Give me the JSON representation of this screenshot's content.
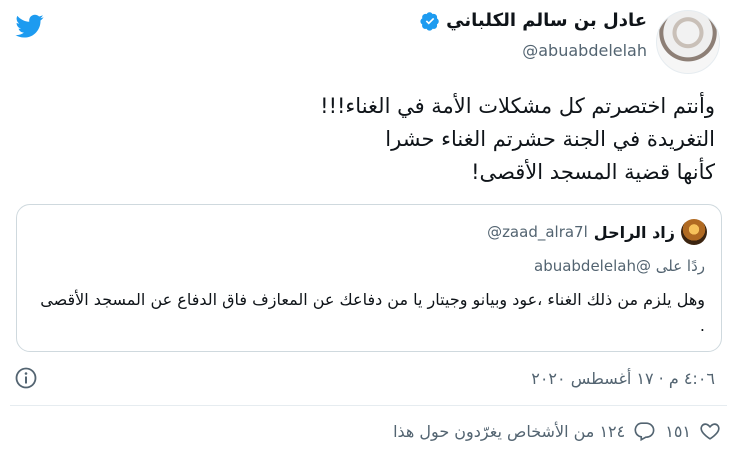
{
  "author": {
    "name": "عادل بن سالم الكلباني",
    "handle": "@abuabdelelah"
  },
  "tweet": {
    "lines": [
      "وأنتم اختصرتم كل مشكلات الأمة في الغناء!!!",
      "التغريدة في الجنة حشرتم الغناء حشرا",
      "كأنها قضية المسجد الأقصى!"
    ]
  },
  "quoted": {
    "name": "زاد الراحل",
    "handle": "@zaad_alra7l",
    "reply_to": "ردًا على @abuabdelelah",
    "text": "وهل يلزم من ذلك الغناء ،عود وبيانو وجيتار يا من دفاعك عن المعازف فاق الدفاع عن المسجد الأقصى ."
  },
  "timestamp": "٤:٠٦ م · ١٧ أغسطس ٢٠٢٠",
  "stats": {
    "likes": "١٥١",
    "replies_label": "١٢٤ من الأشخاص يغرّدون حول هذا"
  },
  "colors": {
    "brand": "#1d9bf0",
    "secondary_text": "#536471"
  }
}
